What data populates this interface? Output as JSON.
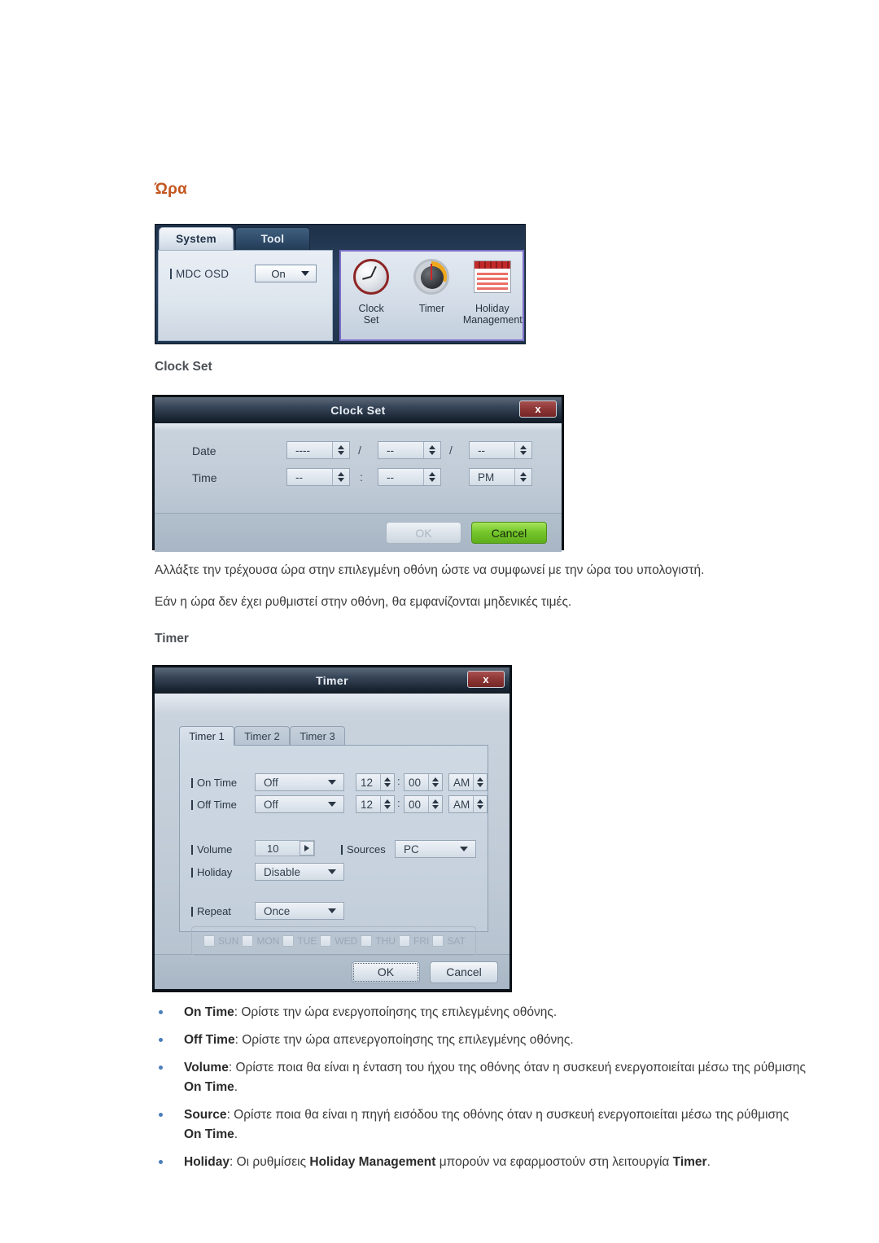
{
  "page": {
    "heading": "Ώρα",
    "subheading_clock": "Clock Set",
    "subheading_timer": "Timer",
    "paragraph1": "Αλλάξτε την τρέχουσα ώρα στην επιλεγμένη οθόνη ώστε να συμφωνεί με την ώρα του υπολογιστή.",
    "paragraph2": "Εάν η ώρα δεν έχει ρυθμιστεί στην οθόνη, θα εμφανίζονται μηδενικές τιμές.",
    "heading_color": "#c4551f"
  },
  "mdc_panel": {
    "tabs": [
      {
        "label": "System",
        "active": true
      },
      {
        "label": "Tool",
        "active": false
      }
    ],
    "osd": {
      "label": "MDC OSD",
      "value": "On"
    },
    "icons": [
      {
        "name": "clock-set-icon",
        "line1": "Clock",
        "line2": "Set"
      },
      {
        "name": "timer-icon",
        "line1": "Timer",
        "line2": ""
      },
      {
        "name": "holiday-management-icon",
        "line1": "Holiday",
        "line2": "Management"
      }
    ],
    "highlight_color": "#7b6fc9"
  },
  "clock_set_dialog": {
    "title": "Clock Set",
    "close_label": "x",
    "rows": [
      {
        "label": "Date",
        "fields": [
          {
            "value": "----"
          },
          {
            "value": "--"
          },
          {
            "value": "--"
          }
        ],
        "separators": [
          "/",
          "/"
        ]
      },
      {
        "label": "Time",
        "fields": [
          {
            "value": "--"
          },
          {
            "value": "--"
          },
          {
            "value": "PM"
          }
        ],
        "separators": [
          ":",
          ""
        ]
      }
    ],
    "buttons": {
      "ok": "OK",
      "cancel": "Cancel",
      "ok_disabled": true,
      "cancel_color": "#76c72c"
    }
  },
  "timer_dialog": {
    "title": "Timer",
    "close_label": "x",
    "tabs": [
      {
        "label": "Timer 1",
        "active": true
      },
      {
        "label": "Timer 2",
        "active": false
      },
      {
        "label": "Timer 3",
        "active": false
      }
    ],
    "on_time": {
      "label": "On Time",
      "mode": "Off",
      "hour": "12",
      "minute": "00",
      "meridiem": "AM",
      "sep": ":"
    },
    "off_time": {
      "label": "Off Time",
      "mode": "Off",
      "hour": "12",
      "minute": "00",
      "meridiem": "AM",
      "sep": ":"
    },
    "volume": {
      "label": "Volume",
      "value": "10"
    },
    "sources": {
      "label": "Sources",
      "value": "PC"
    },
    "holiday": {
      "label": "Holiday",
      "value": "Disable"
    },
    "repeat": {
      "label": "Repeat",
      "value": "Once"
    },
    "days": [
      {
        "label": "SUN",
        "checked": false
      },
      {
        "label": "MON",
        "checked": false
      },
      {
        "label": "TUE",
        "checked": false
      },
      {
        "label": "WED",
        "checked": false
      },
      {
        "label": "THU",
        "checked": false
      },
      {
        "label": "FRI",
        "checked": false
      },
      {
        "label": "SAT",
        "checked": false
      }
    ],
    "buttons": {
      "ok": "OK",
      "cancel": "Cancel"
    }
  },
  "bullets": [
    {
      "term": "On Time",
      "rest": ": Ορίστε την ώρα ενεργοποίησης της επιλεγμένης οθόνης."
    },
    {
      "term": "Off Time",
      "rest": ": Ορίστε την ώρα απενεργοποίησης της επιλεγμένης οθόνης."
    },
    {
      "term": "Volume",
      "rest": ": Ορίστε ποια θα είναι η ένταση του ήχου της οθόνης όταν η συσκευή ενεργοποιείται μέσω της ρύθμισης ",
      "term2": "On Time",
      "tail": "."
    },
    {
      "term": "Source",
      "rest": ": Ορίστε ποια θα είναι η πηγή εισόδου της οθόνης όταν η συσκευή ενεργοποιείται μέσω της ρύθμισης ",
      "term2": "On Time",
      "tail": "."
    },
    {
      "term": "Holiday",
      "rest": ": Οι ρυθμίσεις ",
      "term2": "Holiday Management",
      "rest2": " μπορούν να εφαρμοστούν στη λειτουργία ",
      "term3": "Timer",
      "tail": "."
    }
  ]
}
